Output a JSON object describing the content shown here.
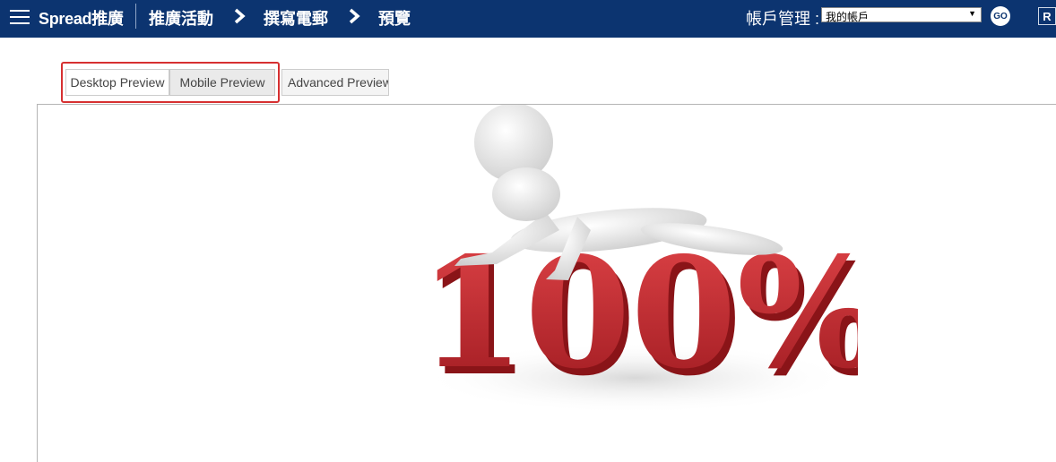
{
  "header": {
    "brand": "Spread推廣",
    "breadcrumb": [
      "推廣活動",
      "撰寫電郵",
      "預覽"
    ],
    "account_label": "帳戶管理 :",
    "account_selected": "我的帳戶",
    "go_label": "GO",
    "r_label": "R"
  },
  "preview_tabs": [
    {
      "label": "Desktop Preview"
    },
    {
      "label": "Mobile Preview"
    },
    {
      "label": "Advanced Preview"
    }
  ],
  "hero_image": {
    "text": "100%",
    "accent_color": "#c9272f"
  },
  "colors": {
    "header_bg": "#0c3470",
    "highlight": "#d63031"
  }
}
